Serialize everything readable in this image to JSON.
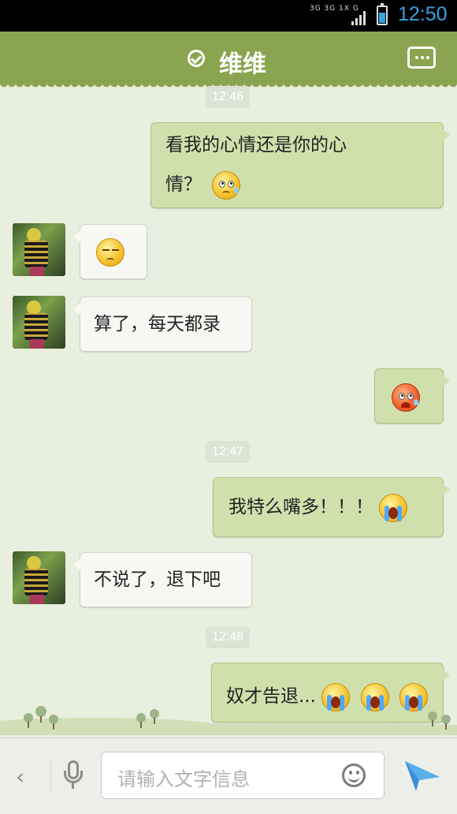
{
  "status_bar": {
    "network": "3G 3G 1X G",
    "time": "12:50"
  },
  "header": {
    "title": "维维"
  },
  "messages": {
    "t1": "12:46",
    "m1": "看我的心情还是你的心",
    "m1b": "情？",
    "m3": "算了，每天都录",
    "t2": "12:47",
    "m5": "我特么嘴多！！！",
    "m6": "不说了，退下吧",
    "t3": "12:48",
    "m7": "奴才告退..."
  },
  "input_bar": {
    "placeholder": "请输入文字信息"
  },
  "colors": {
    "header": "#89a551",
    "outgoing_bubble": "#cfe0ac",
    "incoming_bubble": "#f7f8f4",
    "time_accent": "#3aa3e0",
    "send_icon": "#3a8fd8"
  }
}
